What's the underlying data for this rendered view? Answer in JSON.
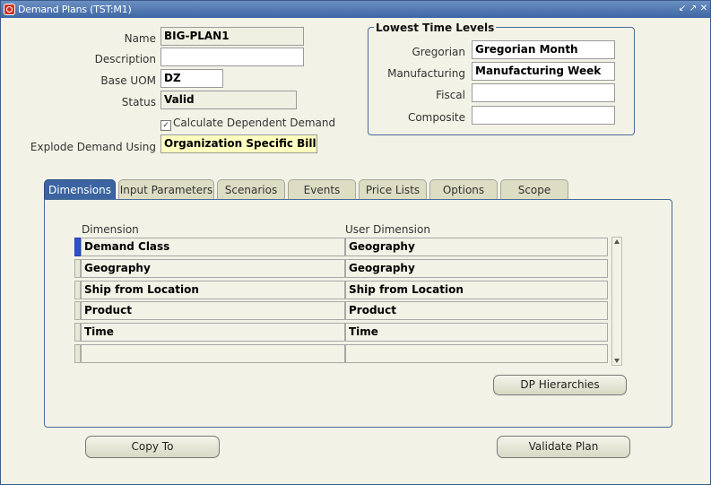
{
  "window": {
    "title": "Demand Plans (TST:M1)"
  },
  "form": {
    "name_label": "Name",
    "name_value": "BIG-PLAN1",
    "description_label": "Description",
    "description_value": "",
    "base_uom_label": "Base UOM",
    "base_uom_value": "DZ",
    "status_label": "Status",
    "status_value": "Valid",
    "calc_dependent_label": "Calculate Dependent Demand",
    "calc_dependent_checked": true,
    "explode_label": "Explode Demand Using",
    "explode_value": "Organization Specific Bill of"
  },
  "time_levels": {
    "title": "Lowest Time Levels",
    "rows": [
      {
        "label": "Gregorian",
        "value": "Gregorian Month"
      },
      {
        "label": "Manufacturing",
        "value": "Manufacturing Week"
      },
      {
        "label": "Fiscal",
        "value": ""
      },
      {
        "label": "Composite",
        "value": ""
      }
    ]
  },
  "tabs": [
    "Dimensions",
    "Input Parameters",
    "Scenarios",
    "Events",
    "Price Lists",
    "Options",
    "Scope"
  ],
  "active_tab": "Dimensions",
  "dimensions_table": {
    "headers": [
      "Dimension",
      "User Dimension"
    ],
    "rows": [
      [
        "Demand Class",
        "Geography"
      ],
      [
        "Geography",
        "Geography"
      ],
      [
        "Ship from Location",
        "Ship from Location"
      ],
      [
        "Product",
        "Product"
      ],
      [
        "Time",
        "Time"
      ],
      [
        "",
        ""
      ]
    ]
  },
  "buttons": {
    "dp_hierarchies": "DP Hierarchies",
    "copy_to": "Copy To",
    "validate_plan": "Validate Plan"
  },
  "colors": {
    "title_bar": "#3d66a4",
    "active_tab": "#3b64a0",
    "highlight_field": "#ffffc0",
    "current_row_marker": "#3050d0"
  }
}
